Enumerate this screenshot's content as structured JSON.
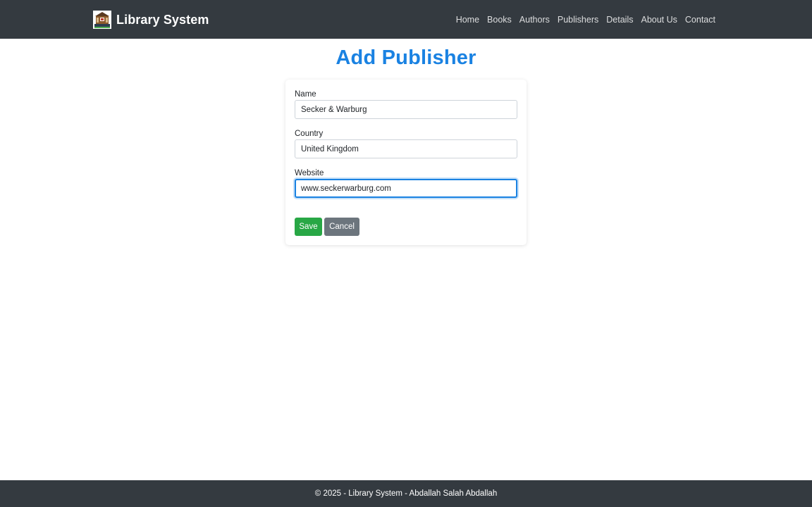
{
  "navbar": {
    "brand": "Library System",
    "logo_icon": "library-building-icon",
    "links": [
      "Home",
      "Books",
      "Authors",
      "Publishers",
      "Details",
      "About Us",
      "Contact"
    ]
  },
  "page": {
    "title": "Add Publisher"
  },
  "form": {
    "name": {
      "label": "Name",
      "value": "Secker & Warburg"
    },
    "country": {
      "label": "Country",
      "value": "United Kingdom"
    },
    "website": {
      "label": "Website",
      "value": "www.seckerwarburg.com"
    },
    "save_label": "Save",
    "cancel_label": "Cancel"
  },
  "footer": {
    "text": "© 2025 - Library System - Abdallah Salah Abdallah"
  },
  "colors": {
    "navbar_bg": "#343a40",
    "title_blue": "#1a82e2",
    "save_green": "#28a745",
    "cancel_gray": "#6c757d"
  }
}
